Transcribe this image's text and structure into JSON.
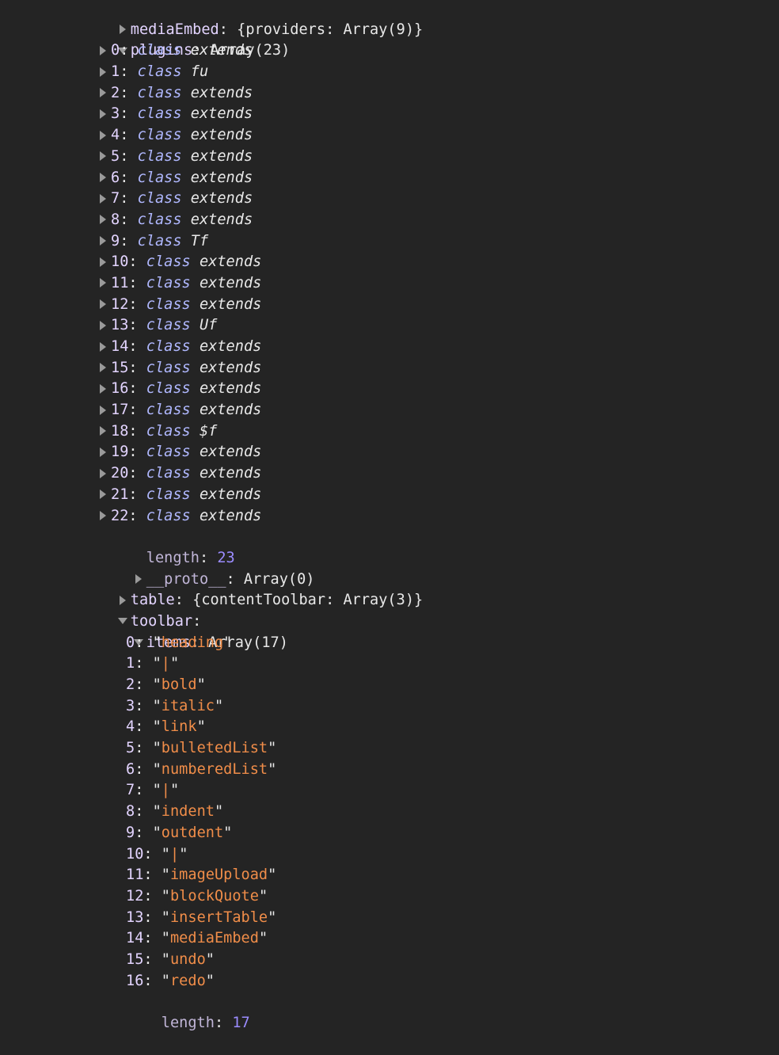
{
  "colors": {
    "background": "#242424",
    "key": "#e3d4ff",
    "string": "#f08d49",
    "number": "#9b8cff",
    "keyword": "#b0b8ff",
    "text": "#e8e8e8"
  },
  "icons": {
    "collapsed": "triangle-right-icon",
    "expanded": "triangle-down-icon"
  },
  "mediaEmbed": {
    "key": "mediaEmbed",
    "summary": "{providers: Array(9)}"
  },
  "plugins": {
    "key": "plugins",
    "summary": "Array(23)",
    "items": [
      {
        "index": "0",
        "keyword": "class",
        "name": "extends"
      },
      {
        "index": "1",
        "keyword": "class",
        "name": "fu"
      },
      {
        "index": "2",
        "keyword": "class",
        "name": "extends"
      },
      {
        "index": "3",
        "keyword": "class",
        "name": "extends"
      },
      {
        "index": "4",
        "keyword": "class",
        "name": "extends"
      },
      {
        "index": "5",
        "keyword": "class",
        "name": "extends"
      },
      {
        "index": "6",
        "keyword": "class",
        "name": "extends"
      },
      {
        "index": "7",
        "keyword": "class",
        "name": "extends"
      },
      {
        "index": "8",
        "keyword": "class",
        "name": "extends"
      },
      {
        "index": "9",
        "keyword": "class",
        "name": "Tf"
      },
      {
        "index": "10",
        "keyword": "class",
        "name": "extends"
      },
      {
        "index": "11",
        "keyword": "class",
        "name": "extends"
      },
      {
        "index": "12",
        "keyword": "class",
        "name": "extends"
      },
      {
        "index": "13",
        "keyword": "class",
        "name": "Uf"
      },
      {
        "index": "14",
        "keyword": "class",
        "name": "extends"
      },
      {
        "index": "15",
        "keyword": "class",
        "name": "extends"
      },
      {
        "index": "16",
        "keyword": "class",
        "name": "extends"
      },
      {
        "index": "17",
        "keyword": "class",
        "name": "extends"
      },
      {
        "index": "18",
        "keyword": "class",
        "name": "$f"
      },
      {
        "index": "19",
        "keyword": "class",
        "name": "extends"
      },
      {
        "index": "20",
        "keyword": "class",
        "name": "extends"
      },
      {
        "index": "21",
        "keyword": "class",
        "name": "extends"
      },
      {
        "index": "22",
        "keyword": "class",
        "name": "extends"
      }
    ],
    "length_key": "length",
    "length_value": "23",
    "proto_key": "__proto__",
    "proto_value": "Array(0)"
  },
  "table": {
    "key": "table",
    "summary": "{contentToolbar: Array(3)}"
  },
  "toolbar": {
    "key": "toolbar",
    "items_key": "items",
    "items_summary": "Array(17)",
    "items": [
      {
        "index": "0",
        "value": "heading"
      },
      {
        "index": "1",
        "value": "|"
      },
      {
        "index": "2",
        "value": "bold"
      },
      {
        "index": "3",
        "value": "italic"
      },
      {
        "index": "4",
        "value": "link"
      },
      {
        "index": "5",
        "value": "bulletedList"
      },
      {
        "index": "6",
        "value": "numberedList"
      },
      {
        "index": "7",
        "value": "|"
      },
      {
        "index": "8",
        "value": "indent"
      },
      {
        "index": "9",
        "value": "outdent"
      },
      {
        "index": "10",
        "value": "|"
      },
      {
        "index": "11",
        "value": "imageUpload"
      },
      {
        "index": "12",
        "value": "blockQuote"
      },
      {
        "index": "13",
        "value": "insertTable"
      },
      {
        "index": "14",
        "value": "mediaEmbed"
      },
      {
        "index": "15",
        "value": "undo"
      },
      {
        "index": "16",
        "value": "redo"
      }
    ],
    "length_key": "length",
    "length_value": "17"
  }
}
